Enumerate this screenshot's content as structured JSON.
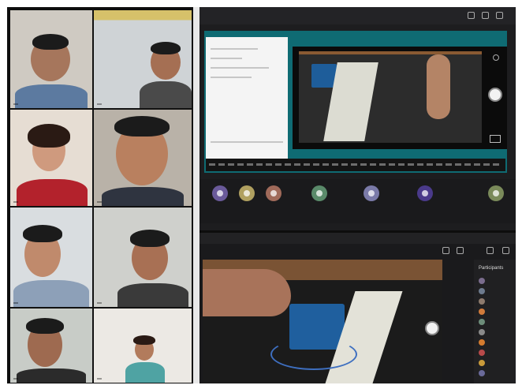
{
  "colors": {
    "frame_bg": "#0d0d0d",
    "ide_teal": "#0f6b73",
    "arduino_blue": "#1f5f9e",
    "skin": "#c98f6a",
    "breadboard": "#dcdcd2"
  },
  "participants": [
    {
      "id": "p1",
      "name": "",
      "icon": "participant-video"
    },
    {
      "id": "p2",
      "name": "",
      "icon": "participant-video"
    },
    {
      "id": "p3",
      "name": "",
      "icon": "participant-video"
    },
    {
      "id": "p4",
      "name": "",
      "icon": "participant-video"
    },
    {
      "id": "p5",
      "name": "",
      "icon": "participant-video"
    },
    {
      "id": "p6",
      "name": "",
      "icon": "participant-video"
    },
    {
      "id": "p7",
      "name": "",
      "icon": "participant-video"
    },
    {
      "id": "p8",
      "name": "",
      "icon": "participant-video"
    }
  ],
  "top_share": {
    "title": "",
    "tray_labels": [
      "",
      "",
      "",
      "",
      ""
    ]
  },
  "bottom_share": {
    "caption": "",
    "panel_title": "Participants"
  },
  "participant_list": [
    {
      "name": "",
      "color": "#7a6c8d"
    },
    {
      "name": "",
      "color": "#6d7a8d"
    },
    {
      "name": "",
      "color": "#8d7a6d"
    },
    {
      "name": "",
      "color": "#d17b3b"
    },
    {
      "name": "",
      "color": "#6d8d7a"
    },
    {
      "name": "",
      "color": "#8a8a8a"
    },
    {
      "name": "",
      "color": "#d47b2f"
    },
    {
      "name": "",
      "color": "#b84a4a"
    },
    {
      "name": "",
      "color": "#c99a3a"
    },
    {
      "name": "",
      "color": "#6a6a9a"
    }
  ]
}
